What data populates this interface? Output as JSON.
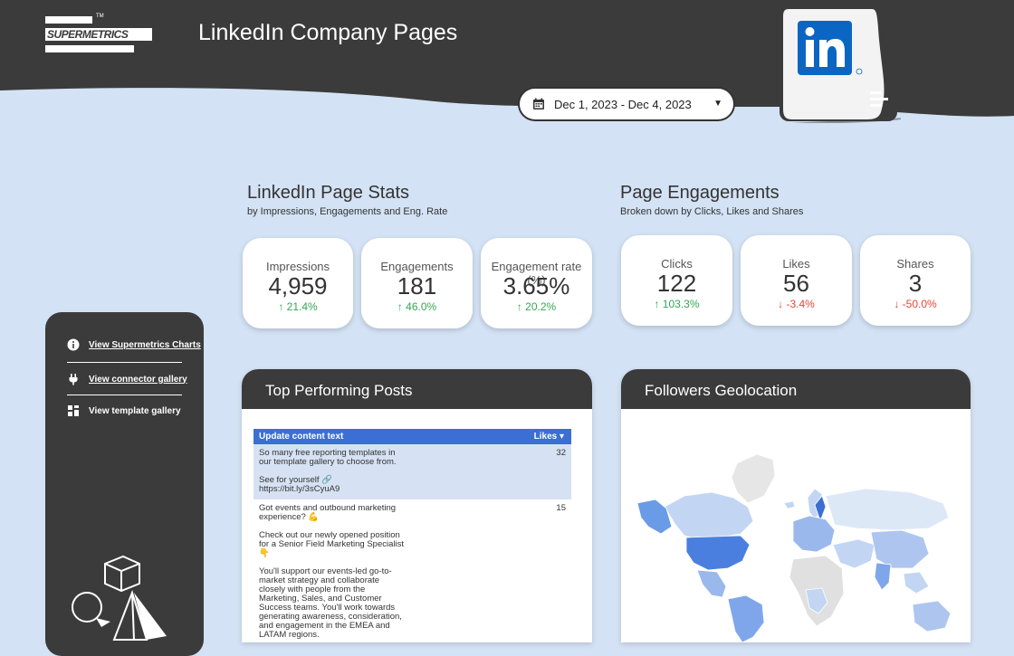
{
  "header": {
    "brand": "SUPERMETRICS",
    "trademark": "TM",
    "title": "LinkedIn Company Pages",
    "logo_icon": "linkedin-icon"
  },
  "date_range": {
    "value": "Dec 1, 2023 - Dec 4, 2023",
    "icon": "calendar-icon"
  },
  "page_stats": {
    "title": "LinkedIn Page Stats",
    "subtitle": "by Impressions, Engagements and Eng. Rate",
    "cards": [
      {
        "label": "Impressions",
        "value": "4,959",
        "delta": "↑ 21.4%",
        "trend": "up"
      },
      {
        "label": "Engagements",
        "value": "181",
        "delta": "↑ 46.0%",
        "trend": "up"
      },
      {
        "label": "Engagement rate (%)",
        "value": "3.65%",
        "delta": "↑ 20.2%",
        "trend": "up"
      }
    ]
  },
  "page_engagements": {
    "title": "Page Engagements",
    "subtitle": "Broken down by Clicks, Likes and Shares",
    "cards": [
      {
        "label": "Clicks",
        "value": "122",
        "delta": "↑ 103.3%",
        "trend": "up"
      },
      {
        "label": "Likes",
        "value": "56",
        "delta": "↓ -3.4%",
        "trend": "down"
      },
      {
        "label": "Shares",
        "value": "3",
        "delta": "↓ -50.0%",
        "trend": "down"
      }
    ]
  },
  "sidebar": {
    "items": [
      {
        "label": "View Supermetrics Charts",
        "icon": "info-icon"
      },
      {
        "label": "View connector gallery",
        "icon": "plug-icon"
      },
      {
        "label": "View template gallery",
        "icon": "grid-icon"
      }
    ]
  },
  "top_posts": {
    "title": "Top Performing Posts",
    "columns": [
      "Update content text",
      "Likes ▾"
    ],
    "rows": [
      {
        "text": "So many free reporting templates in\nour template gallery to choose from.\n\nSee for yourself 🔗\nhttps://bit.ly/3sCyuA9",
        "likes": "32"
      },
      {
        "text": "Got events and outbound marketing\nexperience? 💪\n\nCheck out our newly opened position\nfor a Senior Field Marketing Specialist\n👇\n\nYou'll support our events-led go-to-\nmarket strategy and collaborate\nclosely with people from the\nMarketing, Sales, and Customer\nSuccess teams. You'll work towards\ngenerating awareness, consideration,\nand engagement in the EMEA and\nLATAM regions.",
        "likes": "15"
      }
    ]
  },
  "geo": {
    "title": "Followers Geolocation"
  },
  "colors": {
    "background": "#d3e2f4",
    "dark": "#3b3b3b",
    "table_header": "#3b6fd4",
    "up": "#34a853",
    "down": "#ea4335",
    "linkedin_blue": "#0a66c2"
  }
}
